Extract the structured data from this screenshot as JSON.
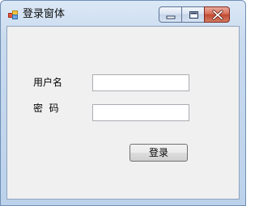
{
  "window": {
    "title": "登录窗体"
  },
  "form": {
    "username_label": "用户名",
    "username_value": "",
    "password_label": "密  码",
    "password_value": "",
    "login_button": "登录"
  },
  "icons": {
    "app": "app-form-icon",
    "minimize": "minimize-icon",
    "maximize": "maximize-icon",
    "close": "close-icon"
  },
  "colors": {
    "close_button": "#c14a32",
    "client_background": "#f0f0f0"
  }
}
